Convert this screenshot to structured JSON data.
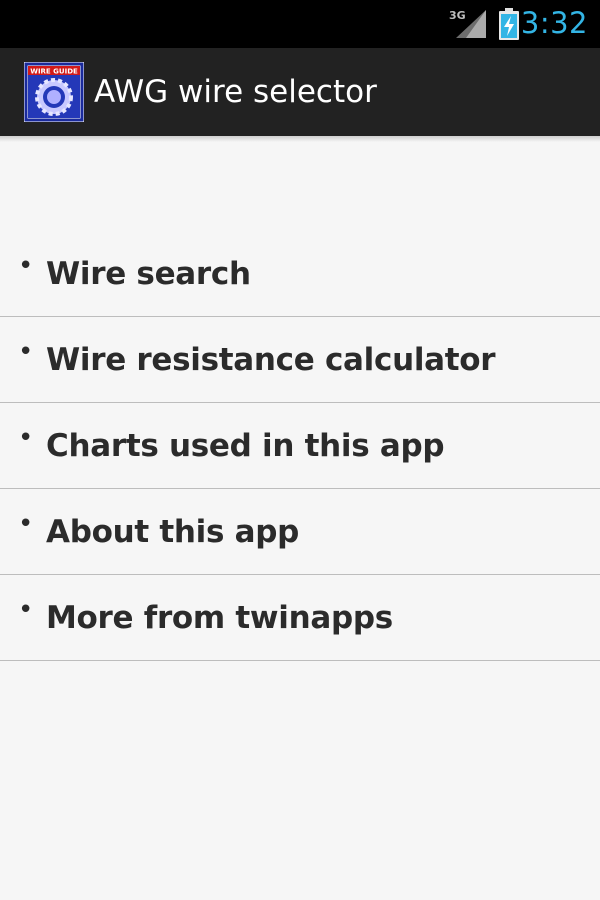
{
  "status_bar": {
    "network_type": "3G",
    "time": "3:32",
    "signal_icon": "signal-icon",
    "battery_icon": "battery-charging-icon",
    "clock_color": "#33b5e5"
  },
  "action_bar": {
    "title": "AWG wire selector",
    "app_icon": "gear-app-icon",
    "app_icon_text": "WIRE GUIDE",
    "background": "#222222"
  },
  "menu": {
    "bullet": "•",
    "items": [
      {
        "label": "Wire search"
      },
      {
        "label": "Wire resistance calculator"
      },
      {
        "label": "Charts used in this app"
      },
      {
        "label": "About this app"
      },
      {
        "label": "More from twinapps"
      }
    ]
  }
}
